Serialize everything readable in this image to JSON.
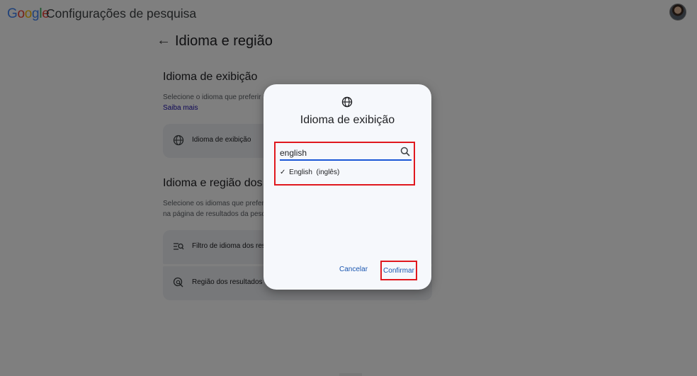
{
  "header": {
    "logo_letters": [
      {
        "char": "G",
        "color": "#4285F4"
      },
      {
        "char": "o",
        "color": "#EA4335"
      },
      {
        "char": "o",
        "color": "#FBBC05"
      },
      {
        "char": "g",
        "color": "#4285F4"
      },
      {
        "char": "l",
        "color": "#34A853"
      },
      {
        "char": "e",
        "color": "#EA4335"
      }
    ],
    "app_title": "Configurações de pesquisa"
  },
  "page": {
    "title": "Idioma e região",
    "section1": {
      "heading": "Idioma de exibição",
      "description": "Selecione o idioma que preferir p",
      "link": "Saiba mais",
      "card_label": "Idioma de exibição"
    },
    "section2": {
      "heading": "Idioma e região dos r",
      "description_line1": "Selecione os idiomas que preferir",
      "description_line2": "na página de resultados da pesq",
      "card1_label": "Filtro de idioma dos resu",
      "card2_label": "Região dos resultados"
    }
  },
  "dialog": {
    "title": "Idioma de exibição",
    "search_value": "english",
    "result_check": "✓",
    "result_label": "English  (inglês)",
    "cancel_label": "Cancelar",
    "confirm_label": "Confirmar"
  },
  "colors": {
    "highlight": "#e0181e",
    "accent": "#1a56d6"
  }
}
